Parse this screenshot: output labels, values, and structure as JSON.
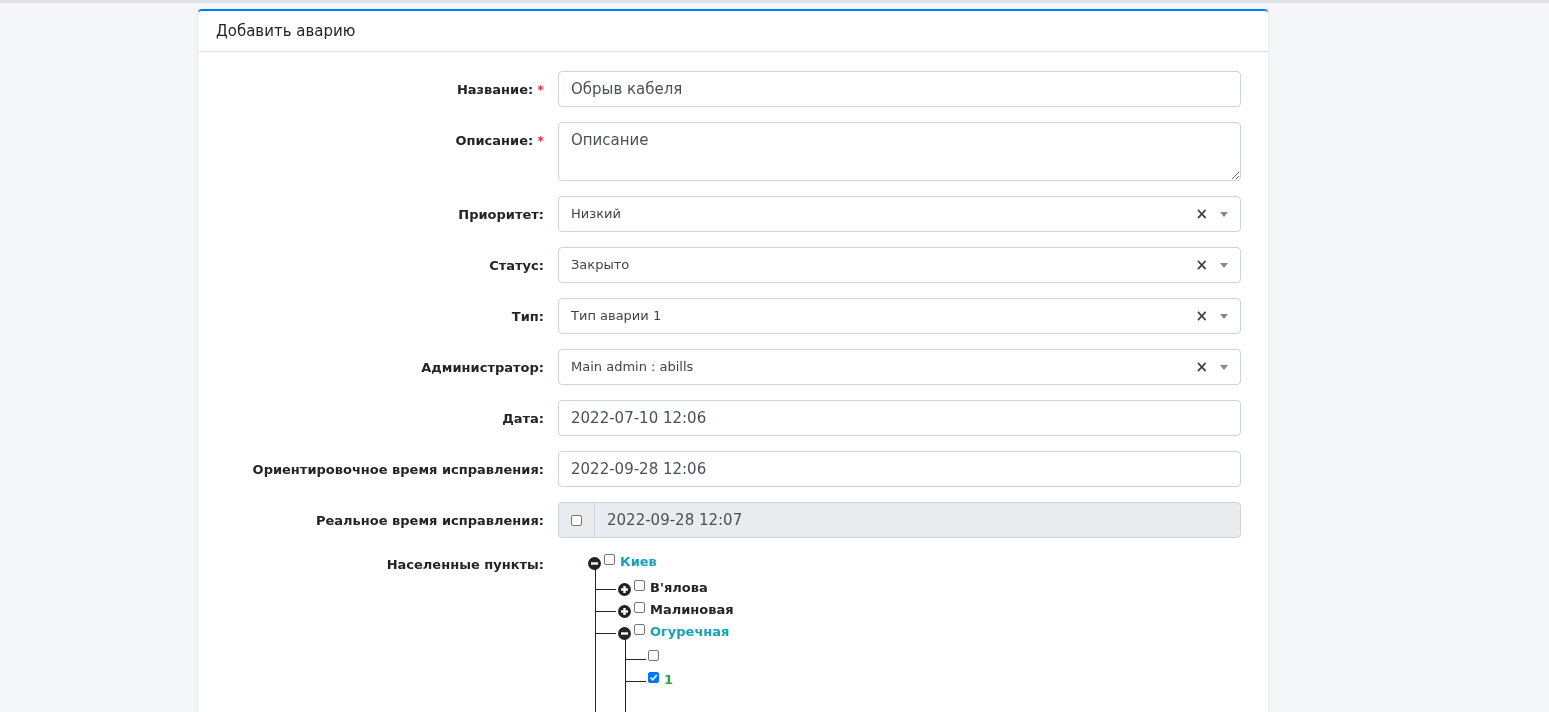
{
  "card": {
    "title": "Добавить аварию"
  },
  "fields": [
    {
      "kind": "text",
      "label": "Название:",
      "required_mark": "*",
      "value": "Обрыв кабеля"
    },
    {
      "kind": "textarea",
      "label": "Описание:",
      "required_mark": "*",
      "placeholder": "Описание"
    },
    {
      "kind": "select",
      "label": "Приоритет:",
      "value": "Низкий",
      "clear": "×"
    },
    {
      "kind": "select",
      "label": "Статус:",
      "value": "Закрыто",
      "clear": "×"
    },
    {
      "kind": "select",
      "label": "Тип:",
      "value": "Тип аварии 1",
      "clear": "×"
    },
    {
      "kind": "select",
      "label": "Администратор:",
      "value": "Main admin : abills",
      "clear": "×"
    },
    {
      "kind": "text",
      "label": "Дата:",
      "value": "2022-07-10 12:06"
    },
    {
      "kind": "text",
      "label": "Ориентировочное время исправления:",
      "value": "2022-09-28 12:06"
    },
    {
      "kind": "check-text",
      "label": "Реальное время исправления:",
      "checked": false,
      "disabled": true,
      "value": "2022-09-28 12:07"
    }
  ],
  "tree": {
    "label": "Населенные пункты:",
    "nodes": [
      {
        "label": "Киев",
        "checked": false,
        "expanded": true,
        "children": [
          {
            "label": "В'ялова",
            "checked": false,
            "expanded": false
          },
          {
            "label": "Малиновая",
            "checked": false,
            "expanded": false
          },
          {
            "label": "Огуречная",
            "checked": false,
            "expanded": true,
            "children": [
              {
                "checked": false
              },
              {
                "label": "1",
                "checked": true
              }
            ]
          }
        ]
      }
    ]
  }
}
